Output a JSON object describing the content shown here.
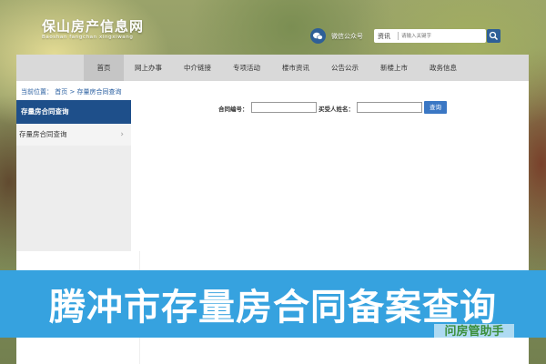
{
  "header": {
    "logo_text": "保山房产信息网",
    "logo_subtitle": "Baoshan fangchan xingxiwang",
    "wechat_label": "微信公众号",
    "search": {
      "category": "资讯",
      "placeholder": "请输入关键字"
    }
  },
  "nav": {
    "items": [
      {
        "label": "首页"
      },
      {
        "label": "网上办事"
      },
      {
        "label": "中介链接"
      },
      {
        "label": "专项活动"
      },
      {
        "label": "楼市资讯"
      },
      {
        "label": "公告公示"
      },
      {
        "label": "新楼上市"
      },
      {
        "label": "政务信息"
      }
    ],
    "active_index": 0
  },
  "breadcrumb": {
    "text": "当前位置：  首页 > 存量房合同查询"
  },
  "sidebar": {
    "heading": "存量房合同查询",
    "items": [
      {
        "label": "存量房合同查询"
      }
    ]
  },
  "form": {
    "contract_no_label": "合同编号：",
    "contract_no_value": "",
    "buyer_name_label": "买受人姓名：",
    "buyer_name_value": "",
    "query_button": "查询"
  },
  "banner": {
    "title": "腾冲市存量房合同备案查询"
  },
  "watermark": {
    "text": "问房管助手"
  },
  "colors": {
    "primary_blue": "#1e4f8a",
    "button_blue": "#3a77c4",
    "banner_blue": "#36a2df",
    "link_blue": "#2a5fa0",
    "nav_bg": "#d9d9d9"
  }
}
